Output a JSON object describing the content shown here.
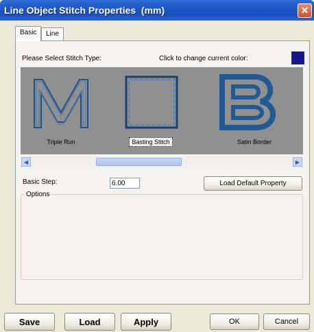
{
  "window": {
    "title": "Line Object Stitch Properties  (mm)",
    "close_glyph": "✕"
  },
  "tabs": [
    {
      "label": "Basic"
    },
    {
      "label": "Line"
    }
  ],
  "panel": {
    "select_type_label": "Please Select Stitch Type:",
    "change_color_label": "Click to change current color:",
    "current_color": "#14168a",
    "stitch_types": [
      {
        "label": "Triple Run",
        "glyph": "M",
        "selected": false
      },
      {
        "label": "Basting Stitch",
        "glyph": "square",
        "selected": true
      },
      {
        "label": "Satin Border",
        "glyph": "B",
        "selected": false
      }
    ],
    "basic_step_label": "Basic Step:",
    "basic_step_value": "6.00",
    "load_default_label": "Load Default Property",
    "options_label": "Options"
  },
  "scrollbar": {
    "left_arrow": "◀",
    "right_arrow": "▶"
  },
  "bottom": {
    "save_label": "Save",
    "load_label": "Load",
    "apply_label": "Apply",
    "ok_label": "OK",
    "cancel_label": "Cancel"
  }
}
